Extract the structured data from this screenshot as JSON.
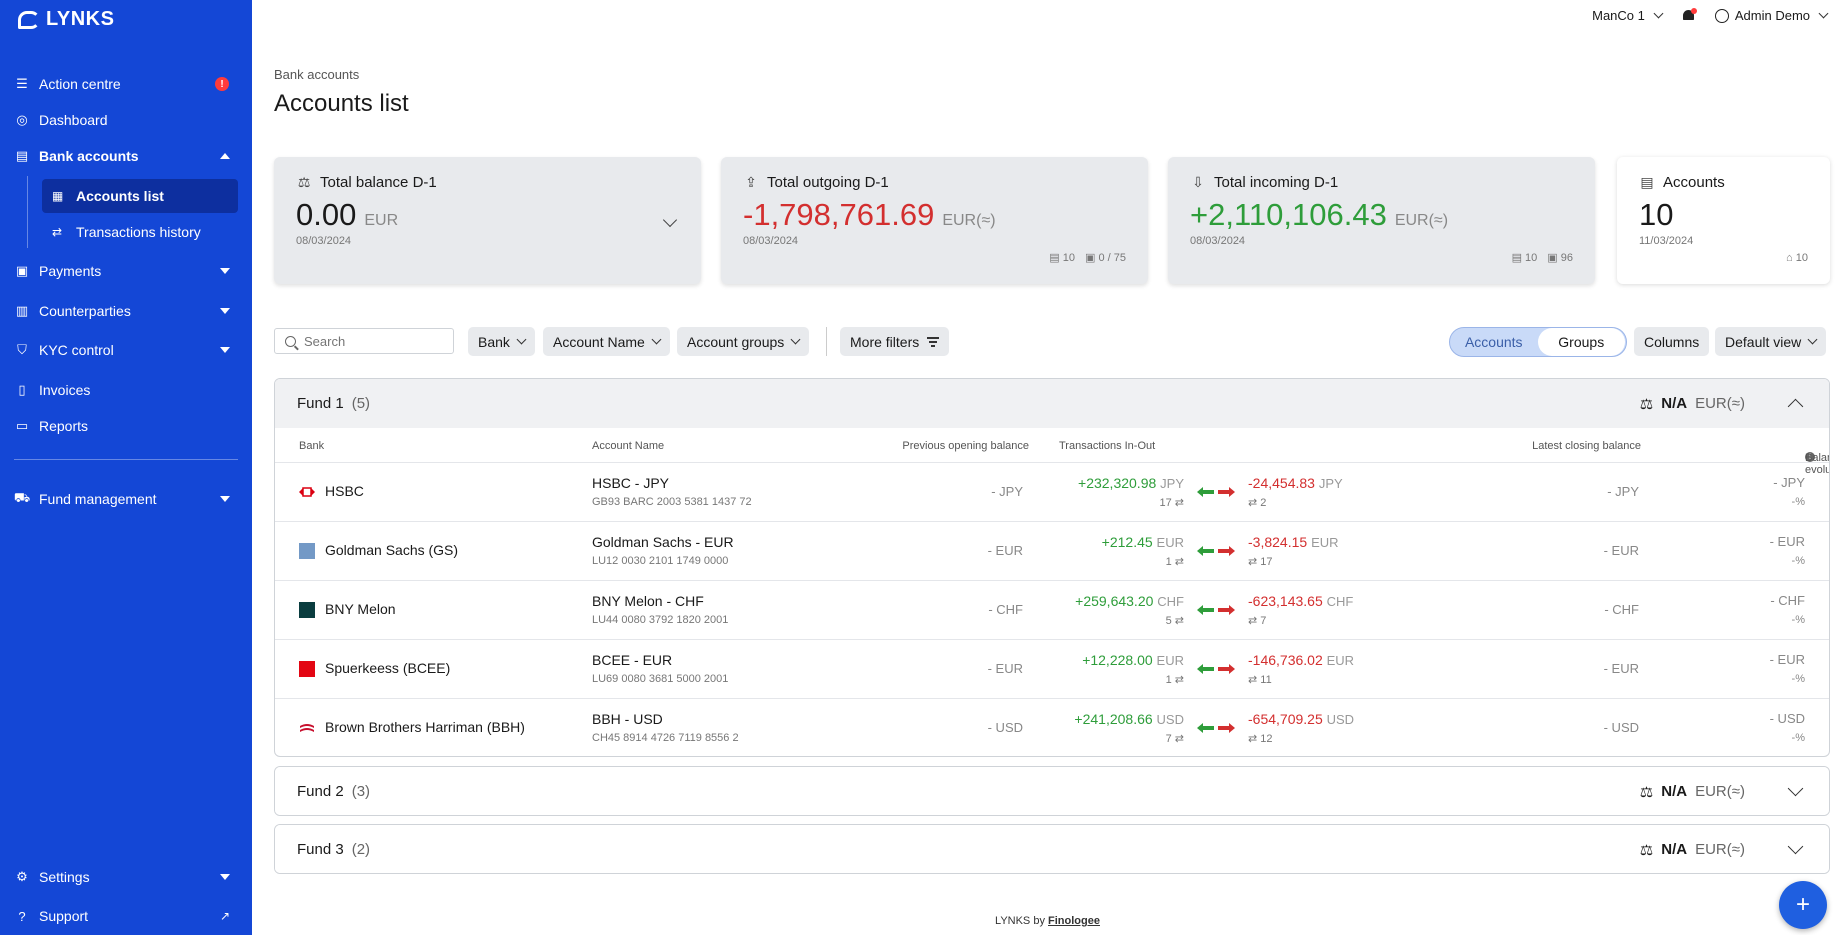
{
  "app": {
    "logo": "LYNKS"
  },
  "sidebar": {
    "items": [
      {
        "label": "Action centre",
        "badge": "!"
      },
      {
        "label": "Dashboard"
      },
      {
        "label": "Bank accounts"
      },
      {
        "label": "Payments"
      },
      {
        "label": "Counterparties"
      },
      {
        "label": "KYC control"
      },
      {
        "label": "Invoices"
      },
      {
        "label": "Reports"
      },
      {
        "label": "Fund management"
      },
      {
        "label": "Settings"
      },
      {
        "label": "Support"
      }
    ],
    "sub_items": [
      {
        "label": "Accounts list",
        "active": true
      },
      {
        "label": "Transactions history"
      }
    ]
  },
  "topbar": {
    "manco": "ManCo 1",
    "user": "Admin Demo"
  },
  "breadcrumb": "Bank accounts",
  "page_title": "Accounts list",
  "cards": {
    "balance": {
      "label": "Total balance D-1",
      "value": "0.00",
      "currency": "EUR",
      "date": "08/03/2024"
    },
    "outgoing": {
      "label": "Total outgoing D-1",
      "value": "-1,798,761.69",
      "currency": "EUR(≈)",
      "date": "08/03/2024",
      "accounts": "10",
      "payments": "0 / 75"
    },
    "incoming": {
      "label": "Total incoming D-1",
      "value": "+2,110,106.43",
      "currency": "EUR(≈)",
      "date": "08/03/2024",
      "accounts": "10",
      "payments": "96"
    },
    "accounts": {
      "label": "Accounts",
      "value": "10",
      "date": "11/03/2024",
      "banks": "10"
    }
  },
  "filters": {
    "search_placeholder": "Search",
    "bank": "Bank",
    "account_name": "Account Name",
    "account_groups": "Account groups",
    "more_filters": "More filters",
    "view_accounts": "Accounts",
    "view_groups": "Groups",
    "columns": "Columns",
    "default_view": "Default view"
  },
  "table_headers": {
    "bank": "Bank",
    "account_name": "Account Name",
    "prev_opening": "Previous opening balance",
    "transactions": "Transactions In-Out",
    "latest_closing": "Latest closing balance",
    "evolution": "Balance evolution"
  },
  "groups": [
    {
      "name": "Fund 1",
      "count": "(5)",
      "balance": "N/A",
      "currency": "EUR(≈)",
      "expanded": true,
      "rows": [
        {
          "bank": "HSBC",
          "account": "HSBC - JPY",
          "iban": "GB93 BARC 2003 5381 1437 72",
          "prev": "- JPY",
          "in": "+232,320.98",
          "in_cur": "JPY",
          "in_count": "17",
          "out": "-24,454.83",
          "out_cur": "JPY",
          "out_count": "2",
          "close": "- JPY",
          "evo": "- JPY",
          "evo_pct": "-%",
          "logo_color": "#db0011"
        },
        {
          "bank": "Goldman Sachs (GS)",
          "account": "Goldman Sachs - EUR",
          "iban": "LU12 0030 2101 1749 0000",
          "prev": "- EUR",
          "in": "+212.45",
          "in_cur": "EUR",
          "in_count": "1",
          "out": "-3,824.15",
          "out_cur": "EUR",
          "out_count": "17",
          "close": "- EUR",
          "evo": "- EUR",
          "evo_pct": "-%",
          "logo_color": "#7399c6"
        },
        {
          "bank": "BNY Melon",
          "account": "BNY Melon - CHF",
          "iban": "LU44 0080 3792 1820 2001",
          "prev": "- CHF",
          "in": "+259,643.20",
          "in_cur": "CHF",
          "in_count": "5",
          "out": "-623,143.65",
          "out_cur": "CHF",
          "out_count": "7",
          "close": "- CHF",
          "evo": "- CHF",
          "evo_pct": "-%",
          "logo_color": "#0a3d3f"
        },
        {
          "bank": "Spuerkeess (BCEE)",
          "account": "BCEE - EUR",
          "iban": "LU69 0080 3681 5000 2001",
          "prev": "- EUR",
          "in": "+12,228.00",
          "in_cur": "EUR",
          "in_count": "1",
          "out": "-146,736.02",
          "out_cur": "EUR",
          "out_count": "11",
          "close": "- EUR",
          "evo": "- EUR",
          "evo_pct": "-%",
          "logo_color": "#e30613"
        },
        {
          "bank": "Brown Brothers Harriman (BBH)",
          "account": "BBH - USD",
          "iban": "CH45 8914 4726 7119 8556 2",
          "prev": "- USD",
          "in": "+241,208.66",
          "in_cur": "USD",
          "in_count": "7",
          "out": "-654,709.25",
          "out_cur": "USD",
          "out_count": "12",
          "close": "- USD",
          "evo": "- USD",
          "evo_pct": "-%",
          "logo_color": "#c8102e"
        }
      ]
    },
    {
      "name": "Fund 2",
      "count": "(3)",
      "balance": "N/A",
      "currency": "EUR(≈)",
      "expanded": false
    },
    {
      "name": "Fund 3",
      "count": "(2)",
      "balance": "N/A",
      "currency": "EUR(≈)",
      "expanded": false
    }
  ],
  "footer": {
    "prefix": "LYNKS by",
    "link": "Finologee"
  },
  "fab": "+"
}
